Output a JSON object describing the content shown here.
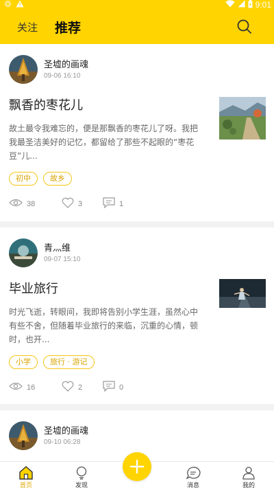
{
  "status_bar": {
    "time": "9:01"
  },
  "header": {
    "tabs": [
      {
        "label": "关注",
        "active": false
      },
      {
        "label": "推荐",
        "active": true
      }
    ],
    "search_icon": "search-icon",
    "accent_color": "#ffd400"
  },
  "feed": {
    "posts": [
      {
        "author": "圣墟的画魂",
        "time": "09-06 16:10",
        "title": "飘香的枣花儿",
        "excerpt": "故土最令我难忘的，便是那飘香的枣花儿了呀。我把我最圣洁美好的记忆，都留给了那些不起眼的“枣花豆”儿...",
        "tags": [
          "初中",
          "故乡"
        ],
        "views": "38",
        "likes": "3",
        "comments": "1"
      },
      {
        "author": "青灬维",
        "time": "09-07 15:10",
        "title": "毕业旅行",
        "excerpt": "时光飞逝，转眼间，我即将告别小学生涯，虽然心中有些不舍，但随着毕业旅行的来临，沉重的心情，顿时，也开...",
        "tags": [
          "小学",
          "旅行 · 游记"
        ],
        "views": "16",
        "likes": "2",
        "comments": "0"
      },
      {
        "author": "圣墟的画魂",
        "time": "09-10 06:28",
        "title": ""
      }
    ]
  },
  "bottom_nav": {
    "items": [
      {
        "label": "首页",
        "icon": "home-icon",
        "active": true
      },
      {
        "label": "发现",
        "icon": "bulb-icon",
        "active": false
      },
      {
        "label": "消息",
        "icon": "chat-icon",
        "active": false
      },
      {
        "label": "我的",
        "icon": "user-icon",
        "active": false
      }
    ],
    "fab_icon": "plus-icon"
  }
}
